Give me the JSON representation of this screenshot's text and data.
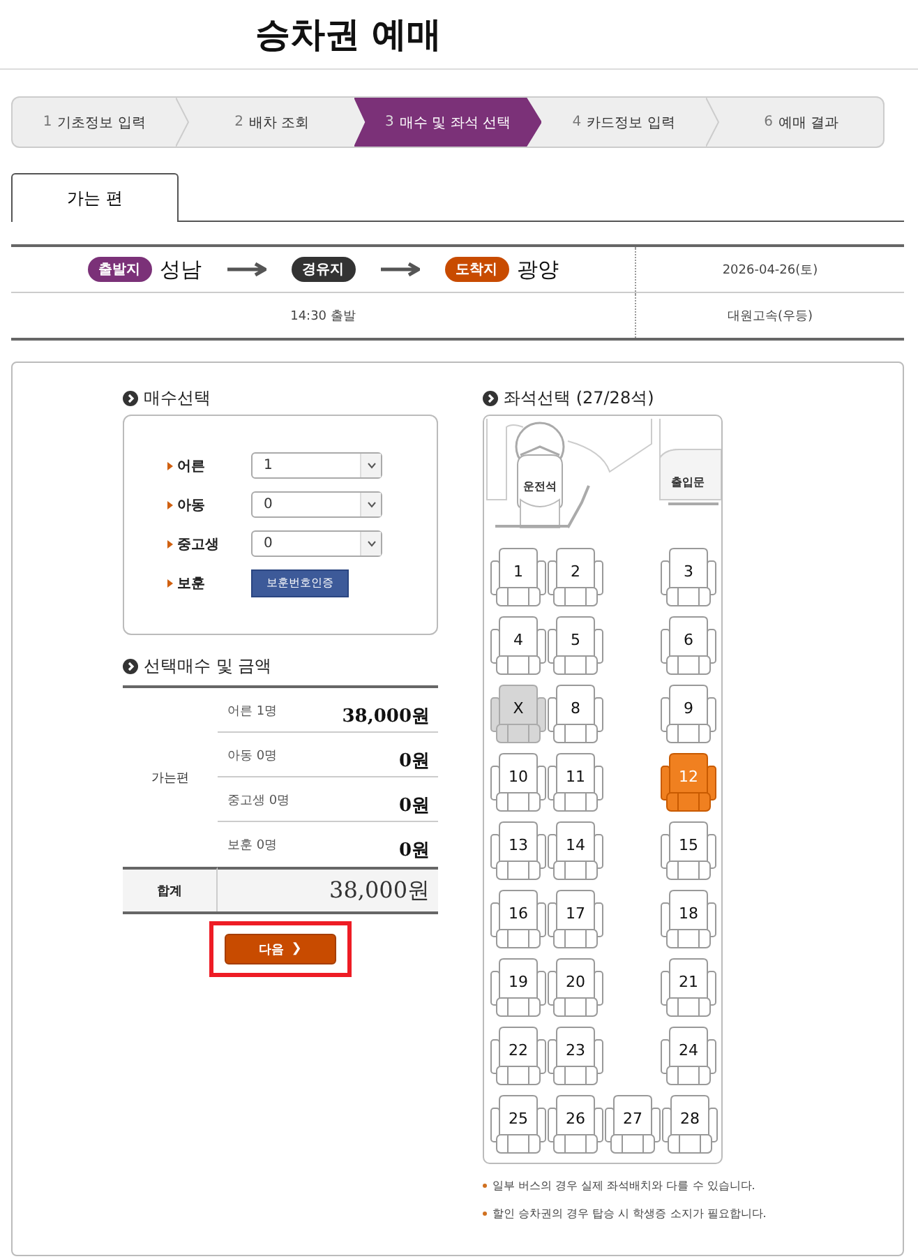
{
  "page_title": "승차권 예매",
  "steps": [
    {
      "number": "1",
      "label": "기초정보 입력",
      "selected": false
    },
    {
      "number": "2",
      "label": "배차 조회",
      "selected": false
    },
    {
      "number": "3",
      "label": "매수 및 좌석 선택",
      "selected": true
    },
    {
      "number": "4",
      "label": "카드정보 입력",
      "selected": false
    },
    {
      "number": "6",
      "label": "예매 결과",
      "selected": false
    }
  ],
  "tabs": [
    {
      "label": "가는 편",
      "selected": true
    }
  ],
  "route": {
    "stops": [
      {
        "badge": "출발지",
        "color": "#7b3178",
        "name": "성남"
      },
      {
        "badge": "경유지",
        "color": "#333333"
      },
      {
        "badge": "도착지",
        "color": "#c84b00",
        "name": "광양"
      }
    ],
    "date": "2026-04-26(토)",
    "departure": "14:30 출발",
    "company": "대원고속(우등)"
  },
  "count_section": {
    "title": "매수선택",
    "rows": [
      {
        "kind": "select",
        "label": "어른",
        "value": "1"
      },
      {
        "kind": "select",
        "label": "아동",
        "value": "0"
      },
      {
        "kind": "select",
        "label": "중고생",
        "value": "0"
      },
      {
        "kind": "button",
        "label": "보훈",
        "button": "보훈번호인증"
      }
    ]
  },
  "summary_section": {
    "title": "선택매수 및 금액",
    "group": "가는편",
    "rows": [
      {
        "label": "어른 1명",
        "amount": "38,000원"
      },
      {
        "label": "아동 0명",
        "amount": "0원"
      },
      {
        "label": "중고생 0명",
        "amount": "0원"
      },
      {
        "label": "보훈 0명",
        "amount": "0원"
      }
    ],
    "total_label": "합계",
    "total": "38,000원"
  },
  "next_button": {
    "label": "다음",
    "icon": "❯",
    "highlighted": true
  },
  "seat_section": {
    "title": "좌석선택 (27/28석)",
    "driver_label": "운전석",
    "door_label": "출입문",
    "rows": [
      [
        {
          "label": "1",
          "selected": false,
          "sold": false
        },
        {
          "label": "2",
          "selected": false,
          "sold": false
        },
        {
          "label": "3",
          "selected": false,
          "sold": false
        }
      ],
      [
        {
          "label": "4",
          "selected": false,
          "sold": false
        },
        {
          "label": "5",
          "selected": false,
          "sold": false
        },
        {
          "label": "6",
          "selected": false,
          "sold": false
        }
      ],
      [
        {
          "label": "X",
          "selected": false,
          "sold": true
        },
        {
          "label": "8",
          "selected": false,
          "sold": false
        },
        {
          "label": "9",
          "selected": false,
          "sold": false
        }
      ],
      [
        {
          "label": "10",
          "selected": false,
          "sold": false
        },
        {
          "label": "11",
          "selected": false,
          "sold": false
        },
        {
          "label": "12",
          "selected": true,
          "sold": false
        }
      ],
      [
        {
          "label": "13",
          "selected": false,
          "sold": false
        },
        {
          "label": "14",
          "selected": false,
          "sold": false
        },
        {
          "label": "15",
          "selected": false,
          "sold": false
        }
      ],
      [
        {
          "label": "16",
          "selected": false,
          "sold": false
        },
        {
          "label": "17",
          "selected": false,
          "sold": false
        },
        {
          "label": "18",
          "selected": false,
          "sold": false
        }
      ],
      [
        {
          "label": "19",
          "selected": false,
          "sold": false
        },
        {
          "label": "20",
          "selected": false,
          "sold": false
        },
        {
          "label": "21",
          "selected": false,
          "sold": false
        }
      ],
      [
        {
          "label": "22",
          "selected": false,
          "sold": false
        },
        {
          "label": "23",
          "selected": false,
          "sold": false
        },
        {
          "label": "24",
          "selected": false,
          "sold": false
        }
      ],
      [
        {
          "label": "25",
          "selected": false,
          "sold": false
        },
        {
          "label": "26",
          "selected": false,
          "sold": false
        },
        {
          "label": "27",
          "selected": false,
          "sold": false
        },
        {
          "label": "28",
          "selected": false,
          "sold": false
        }
      ]
    ],
    "notes": [
      "일부 버스의 경우 실제 좌석배치와 다를 수 있습니다.",
      "할인 승차권의 경우 탑승 시 학생증 소지가 필요합니다."
    ]
  }
}
